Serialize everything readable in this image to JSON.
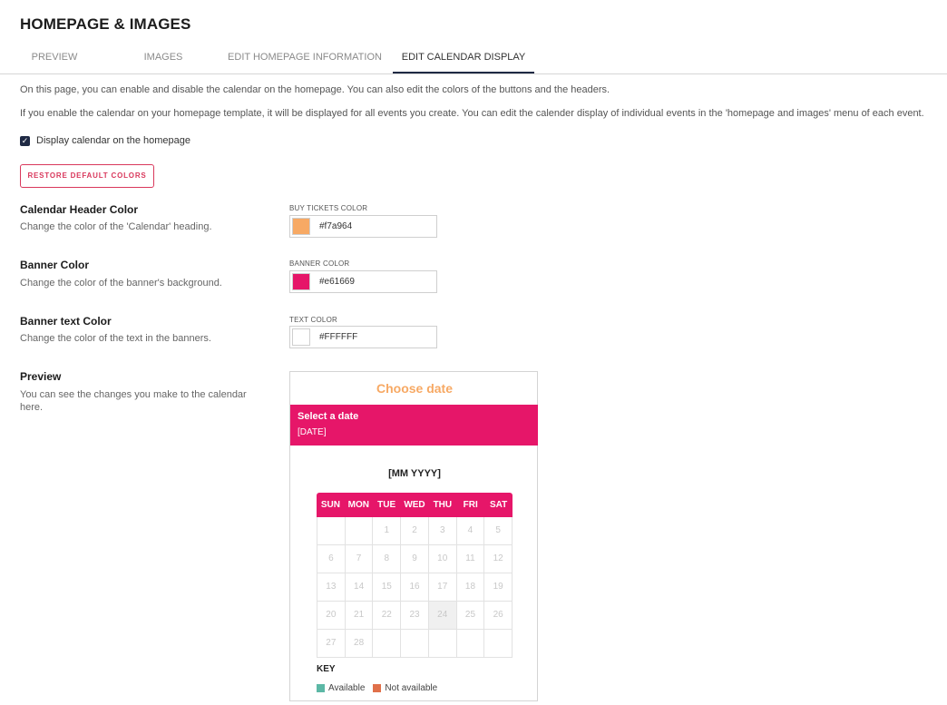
{
  "page": {
    "title": "HOMEPAGE & IMAGES"
  },
  "tabs": [
    {
      "label": "PREVIEW"
    },
    {
      "label": "IMAGES"
    },
    {
      "label": "EDIT HOMEPAGE INFORMATION"
    },
    {
      "label": "EDIT CALENDAR DISPLAY",
      "active": true
    }
  ],
  "intro": {
    "line1": "On this page, you can enable and disable the calendar on the homepage. You can also edit the colors of the buttons and the headers.",
    "line2": "If you enable the calendar on your homepage template, it will be displayed for all events you create. You can edit the calender display of individual events in the 'homepage and images' menu of each event."
  },
  "display_calendar": {
    "label": "Display calendar on the homepage",
    "checked": true
  },
  "restore_button": {
    "label": "RESTORE DEFAULT COLORS"
  },
  "settings": {
    "header": {
      "title": "Calendar Header Color",
      "description": "Change the color of the 'Calendar' heading.",
      "field_label": "BUY TICKETS COLOR",
      "value": "#f7a964"
    },
    "banner": {
      "title": "Banner Color",
      "description": "Change the color of the banner's background.",
      "field_label": "BANNER COLOR",
      "value": "#e61669"
    },
    "text": {
      "title": "Banner text Color",
      "description": "Change the color of the text in the banners.",
      "field_label": "TEXT COLOR",
      "value": "#FFFFFF"
    }
  },
  "preview": {
    "title": "Preview",
    "description": "You can see the changes you make to the calendar here.",
    "choose_date": "Choose date",
    "banner_line1": "Select a date",
    "banner_line2": "[DATE]",
    "month": "[MM YYYY]",
    "weekdays": [
      "SUN",
      "MON",
      "TUE",
      "WED",
      "THU",
      "FRI",
      "SAT"
    ],
    "weeks": [
      [
        "",
        "",
        "1",
        "2",
        "3",
        "4",
        "5"
      ],
      [
        "6",
        "7",
        "8",
        "9",
        "10",
        "11",
        "12"
      ],
      [
        "13",
        "14",
        "15",
        "16",
        "17",
        "18",
        "19"
      ],
      [
        "20",
        "21",
        "22",
        "23",
        "24",
        "25",
        "26"
      ],
      [
        "27",
        "28",
        "",
        "",
        "",
        "",
        ""
      ]
    ],
    "highlighted_day": "24",
    "key_title": "KEY",
    "key": [
      {
        "label": "Available",
        "color": "#5cb8a6"
      },
      {
        "label": "Not available",
        "color": "#e0704a"
      }
    ]
  },
  "colors": {
    "accent": "#1f2a44",
    "restore": "#d9385c",
    "header": "#f7a964",
    "banner": "#e61669",
    "text": "#FFFFFF"
  }
}
